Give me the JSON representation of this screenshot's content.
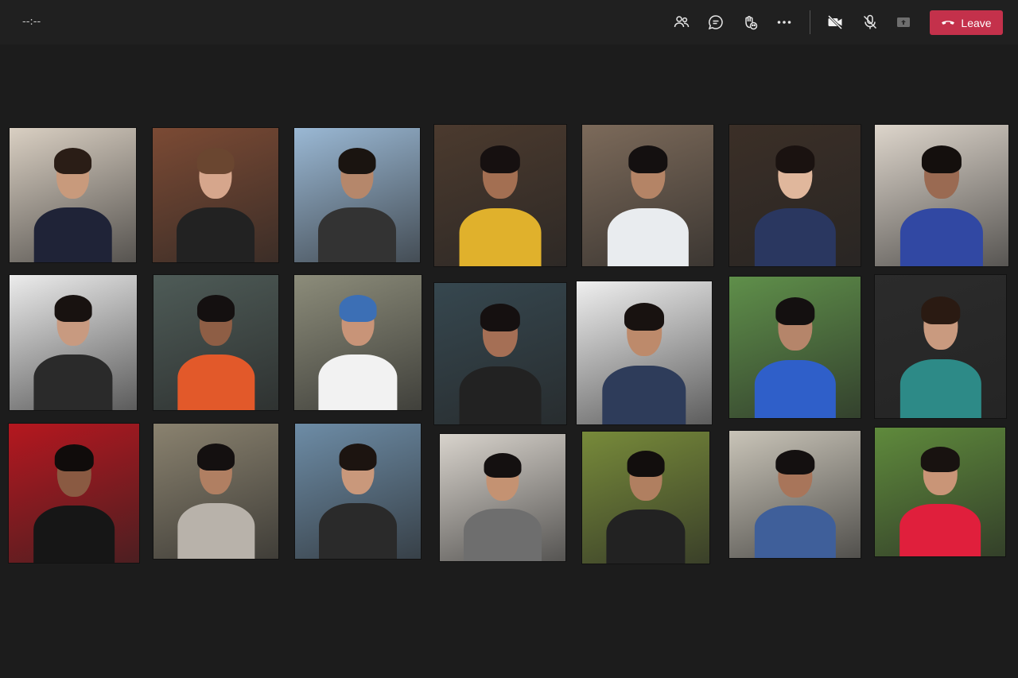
{
  "meeting": {
    "timer": "--:--"
  },
  "toolbar": {
    "icons": [
      "participants-icon",
      "chat-icon",
      "reactions-icon",
      "more-icon",
      "camera-off-icon",
      "mic-off-icon",
      "share-icon"
    ],
    "leave_label": "Leave",
    "leave_color": "#c4314b"
  },
  "tiles": [
    {
      "wall": "#d9cfc2",
      "shirt": "#1f2337",
      "skin": "#c89a7c",
      "hair": "#2a1d16"
    },
    {
      "wall": "#7b4a34",
      "shirt": "#222222",
      "skin": "#d6a68c",
      "hair": "#6a4630"
    },
    {
      "wall": "#9ab8d4",
      "shirt": "#333333",
      "skin": "#b5876b",
      "hair": "#1a1410"
    },
    {
      "wall": "#4b3a2e",
      "shirt": "#e0b12c",
      "skin": "#a36f52",
      "hair": "#161010"
    },
    {
      "wall": "#7c6a5a",
      "shirt": "#e9ecef",
      "skin": "#b48466",
      "hair": "#141010"
    },
    {
      "wall": "#3b2f27",
      "shirt": "#2a3760",
      "skin": "#e0b79c",
      "hair": "#1a1210"
    },
    {
      "wall": "#ddd5cb",
      "shirt": "#3148a3",
      "skin": "#9a6a52",
      "hair": "#140f0d"
    },
    {
      "wall": "#ececec",
      "shirt": "#2a2a2a",
      "skin": "#c89a80",
      "hair": "#181210"
    },
    {
      "wall": "#4e5b57",
      "shirt": "#e2592a",
      "skin": "#8e5e45",
      "hair": "#141010"
    },
    {
      "wall": "#8c8c7a",
      "shirt": "#f2f2f2",
      "skin": "#c89478",
      "hair": "#3c6fb5"
    },
    {
      "wall": "#36474f",
      "shirt": "#222222",
      "skin": "#a56f55",
      "hair": "#151010"
    },
    {
      "wall": "#efefef",
      "shirt": "#2e3c5a",
      "skin": "#bd8a6b",
      "hair": "#181210"
    },
    {
      "wall": "#5f8f4a",
      "shirt": "#2f5fc9",
      "skin": "#b5856a",
      "hair": "#141010"
    },
    {
      "wall": "#2b2b2b",
      "shirt": "#2d8a87",
      "skin": "#c99a7f",
      "hair": "#2a1a12"
    },
    {
      "wall": "#b5171f",
      "shirt": "#161616",
      "skin": "#8a5a42",
      "hair": "#100c0b"
    },
    {
      "wall": "#8a826f",
      "shirt": "#b8b2aa",
      "skin": "#b07f62",
      "hair": "#141010"
    },
    {
      "wall": "#6d8ca6",
      "shirt": "#2a2a2a",
      "skin": "#c9987b",
      "hair": "#1c1410"
    },
    {
      "wall": "#d8d3cc",
      "shirt": "#6e6e6e",
      "skin": "#c49272",
      "hair": "#141010"
    },
    {
      "wall": "#778a3a",
      "shirt": "#222222",
      "skin": "#b07f60",
      "hair": "#120e0d"
    },
    {
      "wall": "#c9c4b8",
      "shirt": "#3f5f9a",
      "skin": "#a8755a",
      "hair": "#141010"
    },
    {
      "wall": "#5f8a3c",
      "shirt": "#e01f3c",
      "skin": "#c99577",
      "hair": "#181210"
    }
  ]
}
